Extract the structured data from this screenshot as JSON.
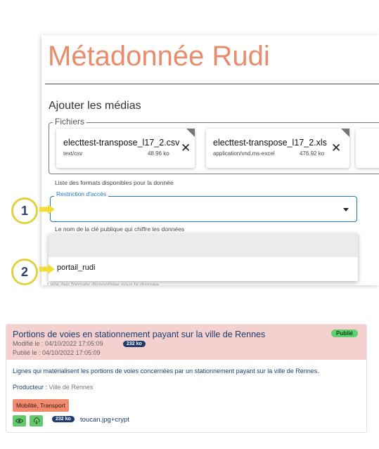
{
  "panel": {
    "title": "Métadonnée Rudi",
    "media_section_title": "Ajouter les médias",
    "files_legend": "Fichiers",
    "files": [
      {
        "name": "electtest-transpose_l17_2.csv",
        "type": "text/csv",
        "size": "48.96 ko"
      },
      {
        "name": "electtest-transpose_l17_2.xls",
        "type": "application/vnd.ms-excel",
        "size": "476.92 ko"
      }
    ],
    "files_helper": "Liste des formats disponibles pour la donnée",
    "restriction": {
      "label": "Restriction d'accès",
      "value": "",
      "helper": "Le nom de la clé publique qui chiffre les données"
    },
    "dropdown": {
      "options": [
        "",
        "portail_rudi"
      ]
    },
    "cut_text": "Liste des formats disponibles pour la donnée"
  },
  "markers": [
    "1",
    "2"
  ],
  "card": {
    "title": "Portions de voies en stationnement payant sur la ville de Rennes",
    "status": "Publié",
    "modified": "Modifié le : 04/10/2022 17:05:09",
    "published": "Publié le : 04/10/2022 17:05:09",
    "size_badge": "232 ko",
    "description": "Lignes qui matérialisent les portions de voies concernées par un stationnement payant sur la ville de Rennes.",
    "producer_label": "Producteur :",
    "producer_value": " Ville de Rennes",
    "themes": "Mobilité, Transport",
    "file_size": "232 ko",
    "file_name": "toucan.jpg+crypt"
  },
  "colors": {
    "title": "#ea8b6b",
    "focus_blue": "#1976d2",
    "marker_ring": "#e2d13f",
    "marker_text": "#2e3d6e",
    "card_header": "#f4d1ce",
    "status_green": "#5bd26d",
    "theme_tag": "#f28b6d",
    "navy": "#1f3a6e"
  },
  "icons": [
    "close-icon",
    "dropdown-arrow-icon",
    "eye-icon",
    "download-icon"
  ]
}
